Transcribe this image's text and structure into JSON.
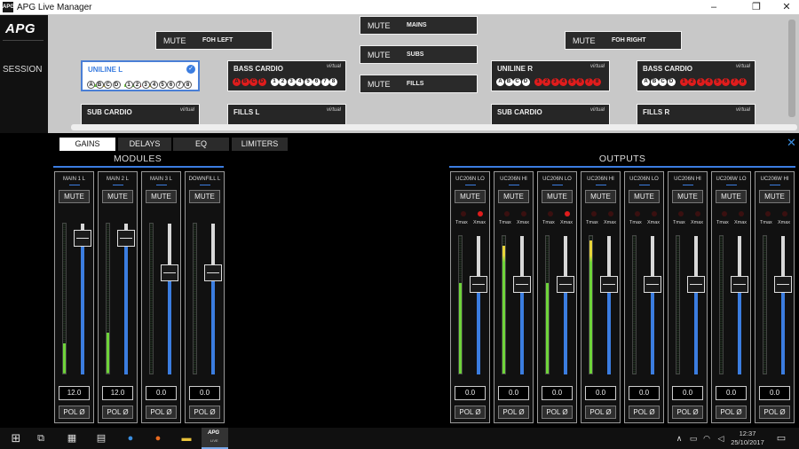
{
  "window": {
    "app_icon": "APG",
    "title": "APG Live Manager",
    "minimize": "–",
    "maximize": "❐",
    "close": "✕"
  },
  "nav": {
    "logo": "APG",
    "session": "SESSION"
  },
  "canvas": {
    "mute_label": "MUTE",
    "mute_buttons": [
      "FOH LEFT",
      "MAINS",
      "SUBS",
      "FILLS",
      "FOH RIGHT"
    ],
    "virtual_label": "virtual",
    "zones": {
      "uniline_l": "UNILINE L",
      "bass_cardio_l": "BASS CARDIO",
      "uniline_r": "UNILINE R",
      "bass_cardio_r": "BASS CARDIO",
      "sub_cardio_l": "SUB CARDIO",
      "fills_l": "FILLS L",
      "sub_cardio_r": "SUB CARDIO",
      "fills_r": "FILLS R"
    },
    "abcd": [
      "A",
      "B",
      "C",
      "D"
    ],
    "numbers": [
      "1",
      "2",
      "3",
      "4",
      "5",
      "6",
      "7",
      "8"
    ],
    "selected_check": "✓"
  },
  "tabs": [
    "GAINS",
    "DELAYS",
    "EQ",
    "LIMITERS"
  ],
  "active_tab": "GAINS",
  "close_panel": "✕",
  "modules": {
    "title": "MODULES",
    "strips": [
      {
        "name": "MAIN 1 L",
        "mute": "MUTE",
        "value": "12.0",
        "pol": "POL Ø",
        "level": 0.2,
        "fader": 0.9
      },
      {
        "name": "MAIN 2 L",
        "mute": "MUTE",
        "value": "12.0",
        "pol": "POL Ø",
        "level": 0.27,
        "fader": 0.9
      },
      {
        "name": "MAIN 3 L",
        "mute": "MUTE",
        "value": "0.0",
        "pol": "POL Ø",
        "level": 0.0,
        "fader": 0.67
      },
      {
        "name": "DOWNFILL L",
        "mute": "MUTE",
        "value": "0.0",
        "pol": "POL Ø",
        "level": 0.0,
        "fader": 0.67
      }
    ]
  },
  "outputs": {
    "title": "OUTPUTS",
    "tmax": "Tmax",
    "xmax": "Xmax",
    "strips": [
      {
        "name": "UC206N LO",
        "mute": "MUTE",
        "value": "0.0",
        "pol": "POL Ø",
        "level": 0.66,
        "fader": 0.65,
        "xmax_on": true
      },
      {
        "name": "UC206N HI",
        "mute": "MUTE",
        "value": "0.0",
        "pol": "POL Ø",
        "level": 0.93,
        "fader": 0.65,
        "xmax_on": false
      },
      {
        "name": "UC206N LO",
        "mute": "MUTE",
        "value": "0.0",
        "pol": "POL Ø",
        "level": 0.66,
        "fader": 0.65,
        "xmax_on": true
      },
      {
        "name": "UC206N HI",
        "mute": "MUTE",
        "value": "0.0",
        "pol": "POL Ø",
        "level": 0.97,
        "fader": 0.65,
        "xmax_on": false
      },
      {
        "name": "UC206N LO",
        "mute": "MUTE",
        "value": "0.0",
        "pol": "POL Ø",
        "level": 0.0,
        "fader": 0.65,
        "xmax_on": false
      },
      {
        "name": "UC206N HI",
        "mute": "MUTE",
        "value": "0.0",
        "pol": "POL Ø",
        "level": 0.0,
        "fader": 0.65,
        "xmax_on": false
      },
      {
        "name": "UC206W LO",
        "mute": "MUTE",
        "value": "0.0",
        "pol": "POL Ø",
        "level": 0.0,
        "fader": 0.65,
        "xmax_on": false
      },
      {
        "name": "UC206W HI",
        "mute": "MUTE",
        "value": "0.0",
        "pol": "POL Ø",
        "level": 0.0,
        "fader": 0.65,
        "xmax_on": false
      }
    ]
  },
  "taskbar": {
    "apg_icon": "APG",
    "apg_sub": "LIVE",
    "time": "12:37",
    "date": "25/10/2017"
  },
  "colors": {
    "accent": "#3b7de0",
    "meter_green": "#6fd43a",
    "meter_yellow": "#e8d53a",
    "meter_red": "#e03a3a",
    "clip_red": "#e01c1c"
  }
}
